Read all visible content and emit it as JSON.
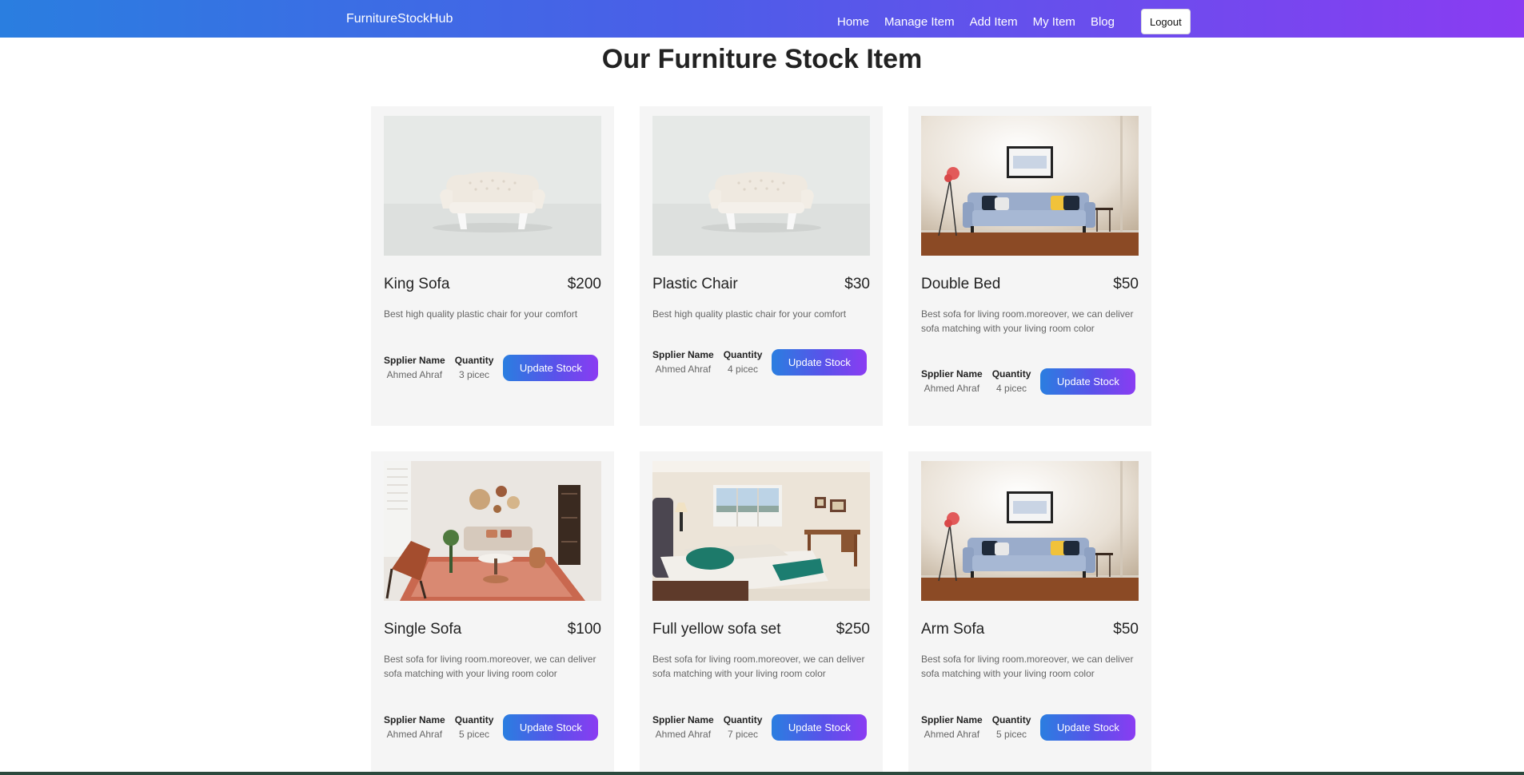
{
  "navbar": {
    "brand": "FurnitureStockHub",
    "links": [
      "Home",
      "Manage Item",
      "Add Item",
      "My Item",
      "Blog"
    ],
    "logout_label": "Logout"
  },
  "page_title": "Our Furniture Stock Item",
  "meta_labels": {
    "supplier": "Spplier Name",
    "quantity": "Quantity"
  },
  "button_label": "Update Stock",
  "items": [
    {
      "name": "King Sofa",
      "price": "$200",
      "description": "Best high quality plastic chair for your comfort",
      "supplier": "Ahmed Ahraf",
      "quantity": "3 picec",
      "image": "white-sofa"
    },
    {
      "name": "Plastic Chair",
      "price": "$30",
      "description": "Best high quality plastic chair for your comfort",
      "supplier": "Ahmed Ahraf",
      "quantity": "4 picec",
      "image": "white-sofa"
    },
    {
      "name": "Double Bed",
      "price": "$50",
      "description": "Best sofa for living room.moreover, we can deliver sofa matching with your living room color",
      "supplier": "Ahmed Ahraf",
      "quantity": "4 picec",
      "image": "blue-sofa"
    },
    {
      "name": "Single Sofa",
      "price": "$100",
      "description": "Best sofa for living room.moreover, we can deliver sofa matching with your living room color",
      "supplier": "Ahmed Ahraf",
      "quantity": "5 picec",
      "image": "living-room"
    },
    {
      "name": "Full yellow sofa set",
      "price": "$250",
      "description": "Best sofa for living room.moreover, we can deliver sofa matching with your living room color",
      "supplier": "Ahmed Ahraf",
      "quantity": "7 picec",
      "image": "bedroom"
    },
    {
      "name": "Arm Sofa",
      "price": "$50",
      "description": "Best sofa for living room.moreover, we can deliver sofa matching with your living room color",
      "supplier": "Ahmed Ahraf",
      "quantity": "5 picec",
      "image": "blue-sofa"
    }
  ]
}
